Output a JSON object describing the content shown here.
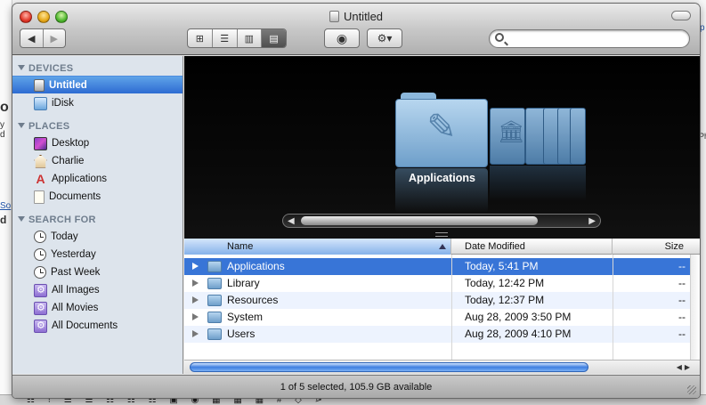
{
  "window": {
    "title": "Untitled",
    "status": "1 of 5 selected, 105.9 GB available"
  },
  "toolbar": {
    "back_icon": "◀",
    "forward_icon": "▶",
    "view_icons": [
      "⊞",
      "☰",
      "▥",
      "▤"
    ],
    "eye_icon": "◉",
    "gear_icon": "⚙▾",
    "search_value": "",
    "search_placeholder": ""
  },
  "sidebar": {
    "devices_header": "DEVICES",
    "devices": [
      {
        "label": "Untitled",
        "icon": "hard-drive-icon",
        "selected": true
      },
      {
        "label": "iDisk",
        "icon": "idisk-icon"
      }
    ],
    "places_header": "PLACES",
    "places": [
      {
        "label": "Desktop",
        "icon": "desktop-icon"
      },
      {
        "label": "Charlie",
        "icon": "home-icon"
      },
      {
        "label": "Applications",
        "icon": "applications-icon"
      },
      {
        "label": "Documents",
        "icon": "documents-icon"
      }
    ],
    "search_header": "SEARCH FOR",
    "searches": [
      {
        "label": "Today",
        "icon": "clock-icon"
      },
      {
        "label": "Yesterday",
        "icon": "clock-icon"
      },
      {
        "label": "Past Week",
        "icon": "clock-icon"
      },
      {
        "label": "All Images",
        "icon": "smart-folder-icon"
      },
      {
        "label": "All Movies",
        "icon": "smart-folder-icon"
      },
      {
        "label": "All Documents",
        "icon": "smart-folder-icon"
      }
    ]
  },
  "coverflow": {
    "current_label": "Applications",
    "scroll_left": "◀",
    "scroll_right": "▶"
  },
  "list": {
    "columns": {
      "name": "Name",
      "date": "Date Modified",
      "size": "Size"
    },
    "rows": [
      {
        "name": "Applications",
        "date": "Today, 5:41 PM",
        "size": "--",
        "selected": true
      },
      {
        "name": "Library",
        "date": "Today, 12:42 PM",
        "size": "--"
      },
      {
        "name": "Resources",
        "date": "Today, 12:37 PM",
        "size": "--"
      },
      {
        "name": "System",
        "date": "Aug 28, 2009 3:50 PM",
        "size": "--"
      },
      {
        "name": "Users",
        "date": "Aug 28, 2009 4:10 PM",
        "size": "--"
      }
    ]
  },
  "background": {
    "left_bits": [
      "o",
      "y d",
      "So",
      "d"
    ],
    "right_bits": [
      "p",
      "Ph"
    ]
  },
  "colors": {
    "selection": "#3875d7",
    "sidebar_bg": "#dde4ec",
    "coverflow_bg": "#000000"
  }
}
